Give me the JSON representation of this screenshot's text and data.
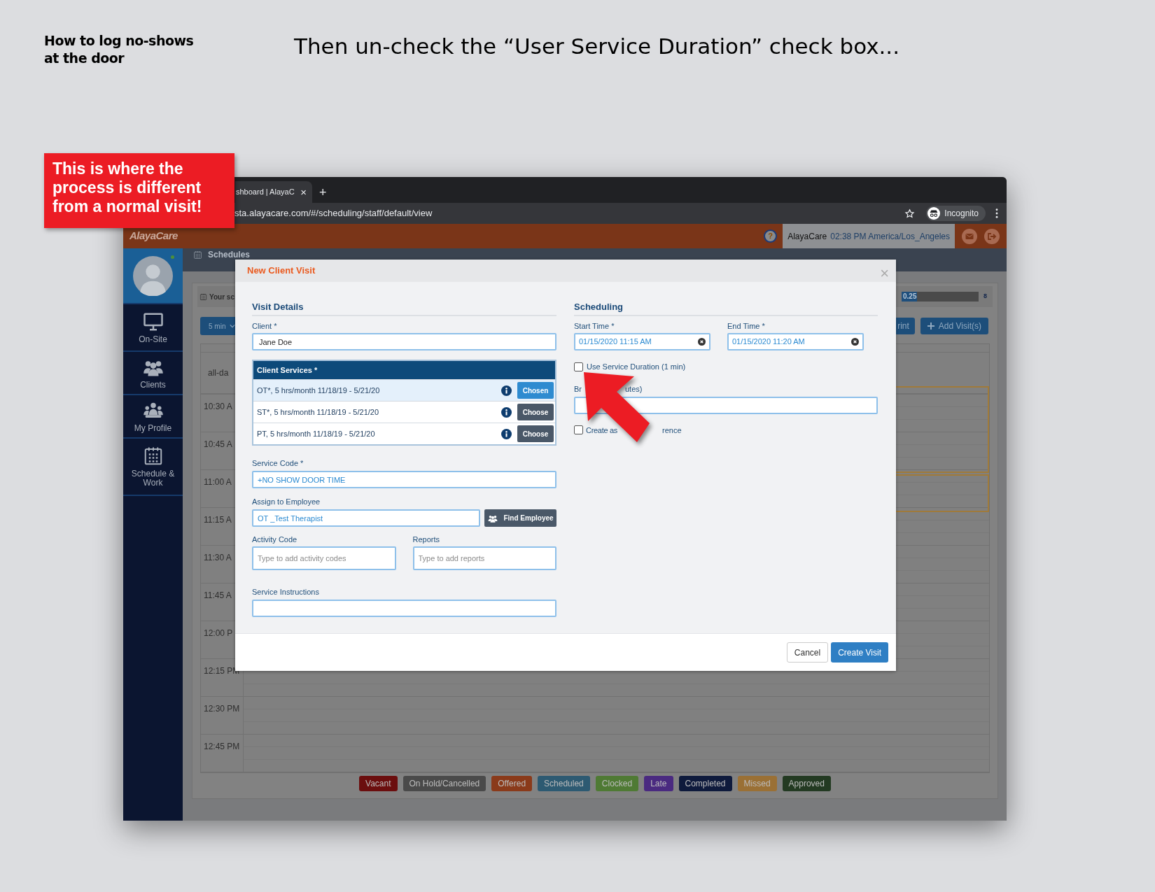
{
  "slide": {
    "subtitle": "How to log no-shows at the door",
    "title": "Then un-check the “User Service Duration” check box...",
    "callout": "This is where the process is different from a normal visit!"
  },
  "browser": {
    "tab_title": "shboard | AlayaC",
    "tab_close": "×",
    "new_tab": "+",
    "url": "sta.alayacare.com/#/scheduling/staff/default/view",
    "profile": "Incognito"
  },
  "app": {
    "logo": "AlayaCare",
    "help": "?",
    "company": "AlayaCare",
    "clock": "02:38 PM America/Los_Angeles"
  },
  "sidebar": {
    "items": [
      {
        "label": "On-Site",
        "kind": "monitor"
      },
      {
        "label": "Clients",
        "kind": "group"
      },
      {
        "label": "My Profile",
        "kind": "team"
      },
      {
        "label": "Schedule & Work",
        "kind": "calendar"
      }
    ]
  },
  "schedule": {
    "title": "Schedules",
    "summary_label": "Your sc",
    "reading": "0.25",
    "level": 0.2,
    "max": "8",
    "interval": "5 min",
    "print": "rint",
    "add": "Add Visit(s)",
    "all_day": "all-da",
    "times": [
      "10:30 A",
      "10:45 A",
      "11:00 A",
      "11:15 A",
      "11:30 A",
      "11:45 A",
      "12:00 P",
      "12:15 PM",
      "12:30 PM",
      "12:45 PM"
    ],
    "legend": [
      {
        "label": "Vacant",
        "color": "#6b0e0e"
      },
      {
        "label": "On Hold/Cancelled",
        "color": "#4a4a4a"
      },
      {
        "label": "Offered",
        "color": "#8a3a1a"
      },
      {
        "label": "Scheduled",
        "color": "#2d5a72"
      },
      {
        "label": "Clocked",
        "color": "#4f7a34"
      },
      {
        "label": "Late",
        "color": "#4a2a80"
      },
      {
        "label": "Completed",
        "color": "#0e1a3c"
      },
      {
        "label": "Missed",
        "color": "#9a7035"
      },
      {
        "label": "Approved",
        "color": "#233a22"
      }
    ]
  },
  "modal": {
    "title": "New Client Visit",
    "close": "×",
    "visit_details": {
      "heading": "Visit Details",
      "client": {
        "label": "Client *",
        "value": "Jane Doe"
      },
      "services": {
        "heading": "Client Services *",
        "rows": [
          {
            "name": "OT*, 5 hrs/month 11/18/19 - 5/21/20",
            "button": "Chosen",
            "selected": true
          },
          {
            "name": "ST*, 5 hrs/month 11/18/19 - 5/21/20",
            "button": "Choose",
            "selected": false
          },
          {
            "name": "PT, 5 hrs/month 11/18/19 - 5/21/20",
            "button": "Choose",
            "selected": false
          }
        ]
      },
      "service_code": {
        "label": "Service Code *",
        "value": "+NO SHOW DOOR TIME"
      },
      "employee": {
        "label": "Assign to Employee",
        "value": "OT _Test Therapist",
        "button": "Find Employee"
      },
      "activity_code": {
        "label": "Activity Code",
        "placeholder": "Type to add activity codes"
      },
      "reports": {
        "label": "Reports",
        "placeholder": "Type to add reports"
      },
      "instructions": {
        "label": "Service Instructions"
      }
    },
    "scheduling": {
      "heading": "Scheduling",
      "start": {
        "label": "Start Time *",
        "value": "01/15/2020 11:15 AM"
      },
      "end": {
        "label": "End Time *",
        "value": "01/15/2020 11:20 AM"
      },
      "use_duration": {
        "label": "Use Service Duration (1 min)",
        "checked": false
      },
      "break": {
        "label_start": "Br",
        "label_end": "utes)"
      },
      "recurrence": {
        "label_start": "Create as",
        "label_end": "rence",
        "checked": false
      }
    },
    "footer": {
      "cancel": "Cancel",
      "submit": "Create Visit"
    }
  }
}
